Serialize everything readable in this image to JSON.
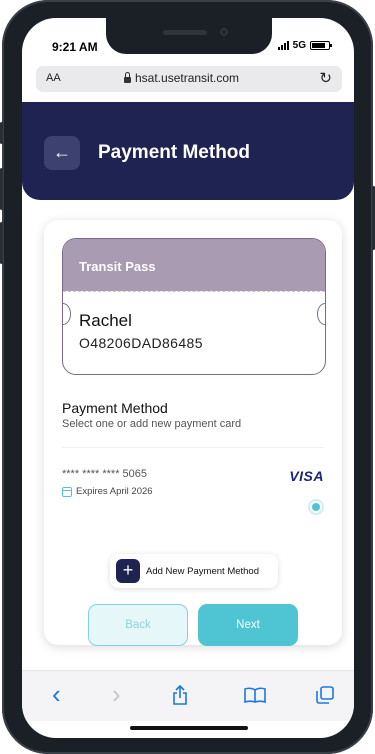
{
  "status": {
    "time": "9:21 AM",
    "network": "5G"
  },
  "browser": {
    "aa_label": "AA",
    "url": "hsat.usetransit.com",
    "reload_glyph": "↻"
  },
  "header": {
    "back_glyph": "←",
    "title": "Payment Method"
  },
  "pass": {
    "title": "Transit Pass",
    "name": "Rachel",
    "id": "O48206DAD86485"
  },
  "payment": {
    "title": "Payment Method",
    "subtitle": "Select one or add new payment card",
    "card_number": "**** **** **** 5065",
    "expiry": "Expires April 2026",
    "brand": "VISA",
    "selected": true
  },
  "actions": {
    "add_glyph": "+",
    "add_label": "Add New Payment Method",
    "back_label": "Back",
    "next_label": "Next"
  },
  "toolbar": {
    "back_glyph": "‹",
    "forward_glyph": "›"
  },
  "colors": {
    "header_bg": "#1f2352",
    "accent": "#4fc5d4",
    "pass_band": "#a99bb2",
    "visa": "#1a237e"
  }
}
